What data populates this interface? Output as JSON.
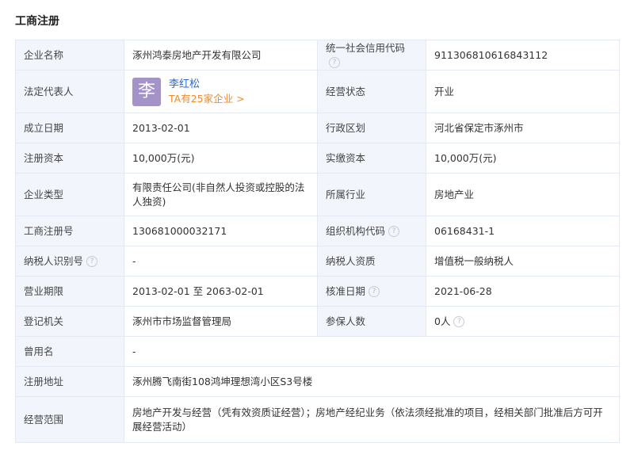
{
  "section_title": "工商注册",
  "question_mark": "?",
  "rows": {
    "company_name": {
      "label": "企业名称",
      "value": "涿州鸿泰房地产开发有限公司"
    },
    "credit_code": {
      "label": "统一社会信用代码",
      "value": "911306810616843112"
    },
    "legal_rep": {
      "label": "法定代表人",
      "avatar_char": "李",
      "name": "李红松",
      "companies_link": "TA有25家企业 >"
    },
    "status": {
      "label": "经营状态",
      "value": "开业"
    },
    "established": {
      "label": "成立日期",
      "value": "2013-02-01"
    },
    "region": {
      "label": "行政区划",
      "value": "河北省保定市涿州市"
    },
    "reg_capital": {
      "label": "注册资本",
      "value": "10,000万(元)"
    },
    "paid_capital": {
      "label": "实缴资本",
      "value": "10,000万(元)"
    },
    "company_type": {
      "label": "企业类型",
      "value": "有限责任公司(非自然人投资或控股的法人独资)"
    },
    "industry": {
      "label": "所属行业",
      "value": "房地产业"
    },
    "reg_number": {
      "label": "工商注册号",
      "value": "130681000032171"
    },
    "org_code": {
      "label": "组织机构代码",
      "value": "06168431-1"
    },
    "taxpayer_id": {
      "label": "纳税人识别号",
      "value": "-"
    },
    "taxpayer_qual": {
      "label": "纳税人资质",
      "value": "增值税一般纳税人"
    },
    "business_term": {
      "label": "营业期限",
      "value": "2013-02-01 至 2063-02-01"
    },
    "approval_date": {
      "label": "核准日期",
      "value": "2021-06-28"
    },
    "reg_authority": {
      "label": "登记机关",
      "value": "涿州市市场监督管理局"
    },
    "insured_count": {
      "label": "参保人数",
      "value": "0人"
    },
    "former_name": {
      "label": "曾用名",
      "value": "-"
    },
    "reg_address": {
      "label": "注册地址",
      "value": "涿州腾飞南街108鸿坤理想湾小区S3号楼"
    },
    "business_scope": {
      "label": "经营范围",
      "value": "房地产开发与经营（凭有效资质证经营）；房地产经纪业务（依法须经批准的项目，经相关部门批准后方可开展经营活动）"
    }
  }
}
